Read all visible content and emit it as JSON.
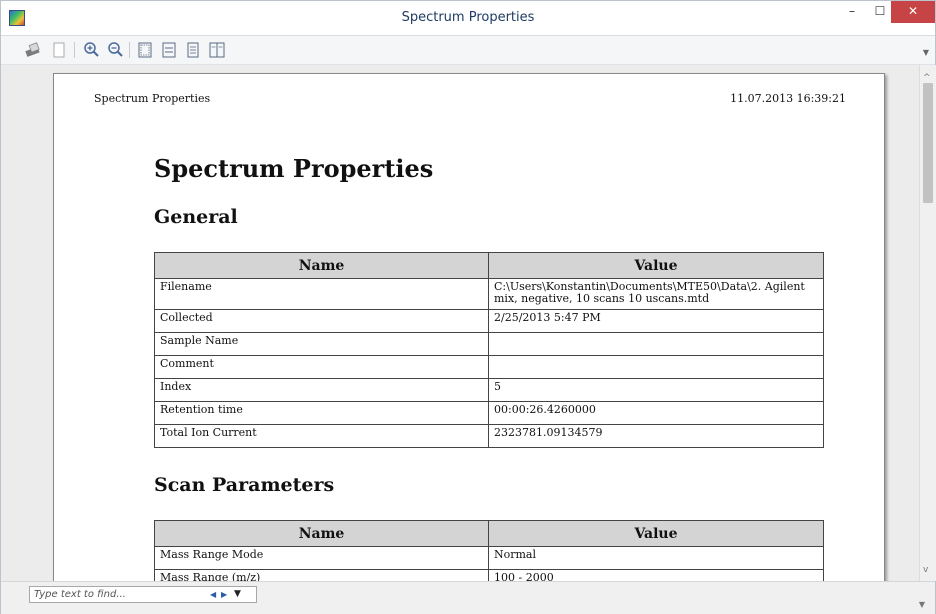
{
  "window": {
    "title": "Spectrum Properties",
    "min_glyph": "–",
    "max_glyph": "☐",
    "close_glyph": "✕"
  },
  "toolbar": {
    "icons": [
      "print-icon",
      "page-setup-icon",
      "zoom-in-icon",
      "zoom-out-icon",
      "fit-page-icon",
      "fit-width-icon",
      "single-page-icon",
      "two-pages-icon"
    ],
    "overflow_glyph": "▼"
  },
  "page": {
    "header_left": "Spectrum Properties",
    "header_right": "11.07.2013 16:39:21",
    "title": "Spectrum Properties",
    "sections": [
      {
        "title": "General",
        "columns": [
          "Name",
          "Value"
        ],
        "rows": [
          {
            "name": "Filename",
            "value": "C:\\Users\\Konstantin\\Documents\\MTE50\\Data\\2.  Agilent mix, negative, 10 scans 10 uscans.mtd"
          },
          {
            "name": "Collected",
            "value": "2/25/2013 5:47 PM"
          },
          {
            "name": "Sample Name",
            "value": ""
          },
          {
            "name": "Comment",
            "value": ""
          },
          {
            "name": "Index",
            "value": "5"
          },
          {
            "name": "Retention time",
            "value": "00:00:26.4260000"
          },
          {
            "name": "Total Ion Current",
            "value": "2323781.09134579"
          }
        ]
      },
      {
        "title": "Scan Parameters",
        "columns": [
          "Name",
          "Value"
        ],
        "rows": [
          {
            "name": "Mass Range Mode",
            "value": "Normal"
          },
          {
            "name": "Mass Range (m/z)",
            "value": "100 - 2000"
          }
        ]
      }
    ]
  },
  "find": {
    "placeholder": "Type text to find...",
    "prev_glyph": "◀",
    "next_glyph": "▶",
    "options_glyph": "▼"
  },
  "scrollbar": {
    "up_glyph": "^",
    "down_glyph": "v"
  },
  "colors": {
    "close_button": "#c74446",
    "title_text": "#1f3b63",
    "table_header": "#d4d4d4"
  }
}
